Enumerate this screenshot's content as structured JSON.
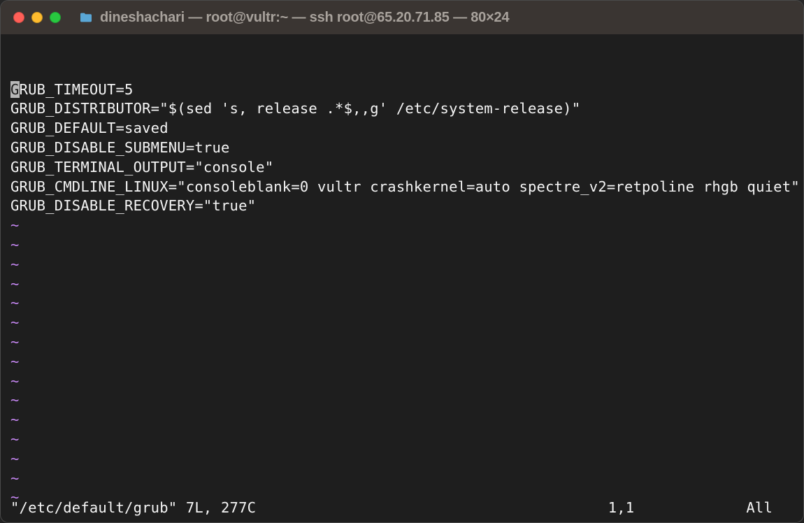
{
  "titlebar": {
    "title": "dineshachari — root@vultr:~ — ssh root@65.20.71.85 — 80×24"
  },
  "content": {
    "lines": [
      "GRUB_TIMEOUT=5",
      "GRUB_DISTRIBUTOR=\"$(sed 's, release .*$,,g' /etc/system-release)\"",
      "GRUB_DEFAULT=saved",
      "GRUB_DISABLE_SUBMENU=true",
      "GRUB_TERMINAL_OUTPUT=\"console\"",
      "GRUB_CMDLINE_LINUX=\"consoleblank=0 vultr crashkernel=auto spectre_v2=retpoline rhgb quiet\"",
      "GRUB_DISABLE_RECOVERY=\"true\""
    ],
    "tilde": "~",
    "tilde_count": 15
  },
  "status": {
    "file": "\"/etc/default/grub\" 7L, 277C",
    "position": "1,1",
    "scroll": "All"
  },
  "cursor": {
    "line": 0,
    "col": 0
  }
}
